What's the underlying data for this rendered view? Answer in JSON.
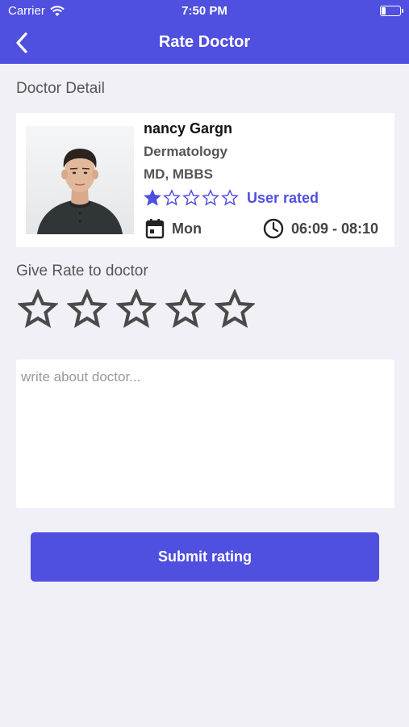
{
  "status_bar": {
    "carrier": "Carrier",
    "time": "7:50 PM"
  },
  "nav": {
    "title": "Rate Doctor",
    "back_icon": "chevron-left-icon"
  },
  "doctor_detail": {
    "section_title": "Doctor Detail",
    "name": "nancy Gargn",
    "specialty": "Dermatology",
    "degree": "MD, MBBS",
    "rating_value": 1,
    "rating_max": 5,
    "rating_label": "User rated",
    "day": "Mon",
    "time_range": "06:09 - 08:10"
  },
  "give_rate": {
    "title": "Give Rate to doctor",
    "selected": 0,
    "max": 5
  },
  "review": {
    "placeholder": "write about doctor...",
    "value": ""
  },
  "submit": {
    "label": "Submit rating"
  },
  "colors": {
    "accent": "#4f4fe0",
    "background": "#f0f0f6"
  }
}
